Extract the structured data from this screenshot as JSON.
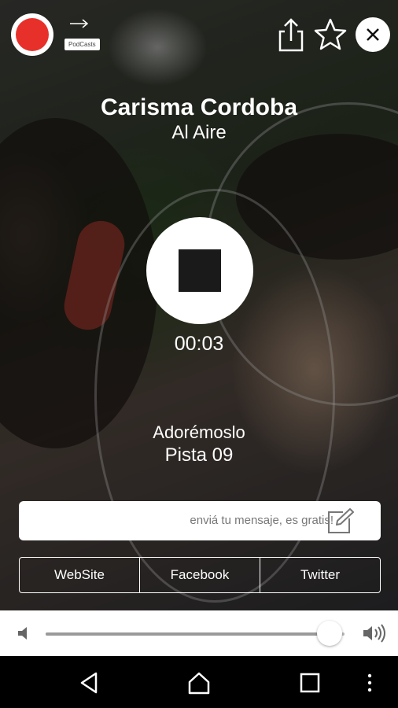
{
  "player": {
    "station": "Carisma Cordoba",
    "status": "Al Aire",
    "elapsed": "00:03",
    "artist": "Adorémoslo",
    "track": "Pista 09"
  },
  "podcasts_badge": "PodCasts",
  "message": {
    "placeholder": "enviá tu mensaje, es gratis!"
  },
  "links": [
    "WebSite",
    "Facebook",
    "Twitter"
  ],
  "volume": {
    "level": 0.95
  },
  "colors": {
    "record": "#e8302a",
    "panel": "#ffffff",
    "text": "#ffffff"
  },
  "icons": [
    "record-icon",
    "podcasts-icon",
    "share-icon",
    "star-icon",
    "close-icon",
    "stop-icon",
    "edit-icon",
    "volume-mute-icon",
    "volume-up-icon",
    "back-icon",
    "home-icon",
    "recents-icon",
    "more-icon"
  ]
}
